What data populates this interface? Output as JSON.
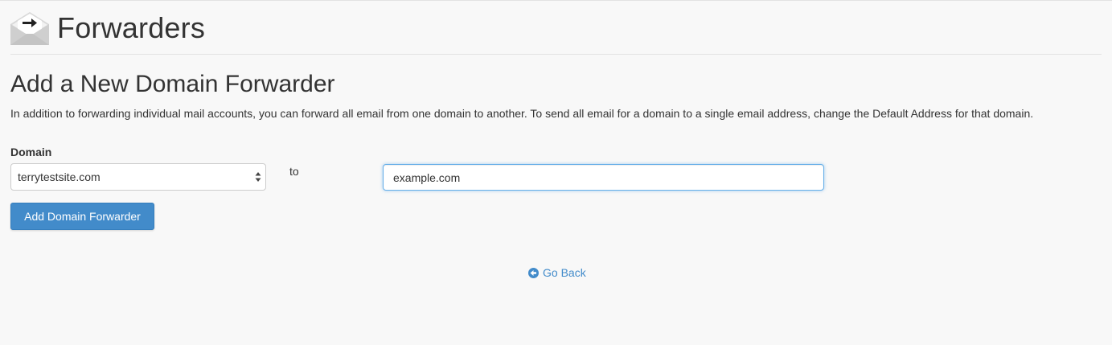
{
  "header": {
    "title": "Forwarders",
    "icon": "envelope-forward-icon"
  },
  "section": {
    "title": "Add a New Domain Forwarder",
    "description": "In addition to forwarding individual mail accounts, you can forward all email from one domain to another. To send all email for a domain to a single email address, change the Default Address for that domain."
  },
  "form": {
    "domain_label": "Domain",
    "domain_selected": "terrytestsite.com",
    "to_label": "to",
    "destination_value": "example.com",
    "submit_label": "Add Domain Forwarder"
  },
  "footer": {
    "go_back_label": "Go Back",
    "go_back_icon": "arrow-circle-left-icon"
  },
  "colors": {
    "accent": "#428bca",
    "background": "#f8f8f8",
    "text": "#333333"
  }
}
